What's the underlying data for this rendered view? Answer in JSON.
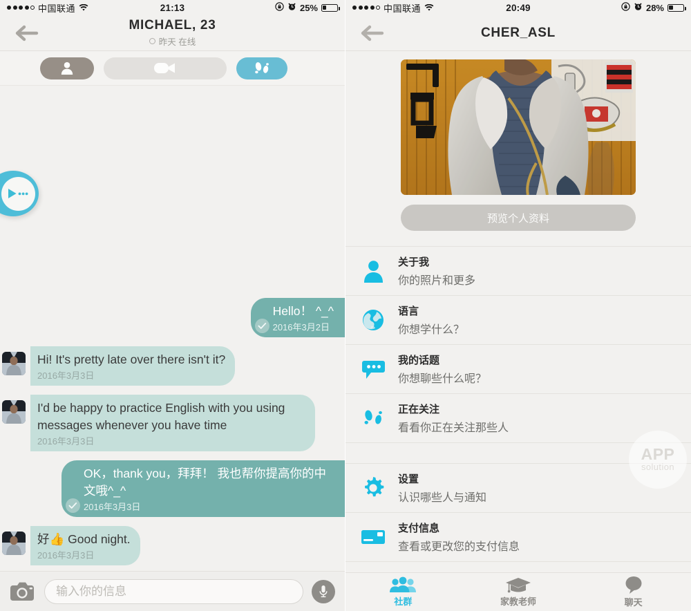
{
  "theme": {
    "accent_cyan": "#2ebde0",
    "accent_teal_bubble_out": "#74b1ac",
    "accent_mint_bubble_in": "#c5dfda",
    "page_bg": "#f2f1ef",
    "segment_active_footprint": "#68bdd4",
    "segment_profile": "#978f87",
    "segment_video": "#e2e0dd"
  },
  "left_phone": {
    "status_bar": {
      "signal_dots": 5,
      "signal_filled": 4,
      "carrier": "中国联通",
      "wifi_icon": "wifi-icon",
      "time": "21:13",
      "rotation_lock_icon": "rotation-lock-icon",
      "alarm_icon": "alarm-clock-icon",
      "battery_percent": "25%",
      "battery_level": 25
    },
    "nav": {
      "back_icon": "back-arrow-icon",
      "title": "MICHAEL, 23",
      "subtitle": "昨天 在线",
      "status_ring_icon": "status-ring-icon"
    },
    "segments": [
      {
        "name": "profile",
        "icon": "person-icon",
        "state": "inactive-dark"
      },
      {
        "name": "video",
        "icon": "video-camera-icon",
        "state": "disabled"
      },
      {
        "name": "footprint",
        "icon": "footprints-icon",
        "state": "active"
      }
    ],
    "floating_badge": {
      "icon": "pacman-chat-icon"
    },
    "messages": [
      {
        "side": "out",
        "text": "Hello！ ^_^",
        "time": "2016年3月2日",
        "read_receipt": true
      },
      {
        "side": "in",
        "text": "Hi! It's pretty late over there isn't it?",
        "time": "2016年3月3日",
        "avatar": "michael-avatar"
      },
      {
        "side": "in",
        "text": "I'd be happy to practice English with you using messages whenever you have time",
        "time": "2016年3月3日",
        "avatar": "michael-avatar"
      },
      {
        "side": "out",
        "text": "OK，thank you，拜拜！ 我也帮你提高你的中文哦^_^",
        "time": "2016年3月3日",
        "read_receipt": true
      },
      {
        "side": "in",
        "text": "好👍 Good night.",
        "time": "2016年3月3日",
        "avatar": "michael-avatar"
      }
    ],
    "input_bar": {
      "camera_icon": "camera-icon",
      "placeholder": "输入你的信息",
      "value": "",
      "mic_icon": "microphone-icon"
    }
  },
  "right_phone": {
    "status_bar": {
      "signal_dots": 5,
      "signal_filled": 4,
      "carrier": "中国联通",
      "wifi_icon": "wifi-icon",
      "time": "20:49",
      "rotation_lock_icon": "rotation-lock-icon",
      "alarm_icon": "alarm-clock-icon",
      "battery_percent": "28%",
      "battery_level": 28
    },
    "nav": {
      "back_icon": "back-arrow-icon",
      "title": "CHER_ASL"
    },
    "profile_photo": {
      "name": "profile-photo"
    },
    "preview_button": "预览个人资料",
    "settings_items": [
      {
        "icon": "person-icon",
        "title": "关于我",
        "subtitle": "你的照片和更多"
      },
      {
        "icon": "globe-icon",
        "title": "语言",
        "subtitle": "你想学什么？"
      },
      {
        "icon": "speech-bubble-icon",
        "title": "我的话题",
        "subtitle": "你想聊些什么呢？"
      },
      {
        "icon": "footprints-icon",
        "title": "正在关注",
        "subtitle": "看看你正在关注那些人"
      },
      {
        "icon": "gear-icon",
        "title": "设置",
        "subtitle": "认识哪些人与通知"
      },
      {
        "icon": "credit-card-icon",
        "title": "支付信息",
        "subtitle": "查看或更改您的支付信息"
      }
    ],
    "watermark": {
      "line1": "APP",
      "line2": "solution"
    },
    "tabs": [
      {
        "icon": "people-group-icon",
        "label": "社群",
        "active": true
      },
      {
        "icon": "graduation-cap-icon",
        "label": "家教老师",
        "active": false
      },
      {
        "icon": "chat-bubble-icon",
        "label": "聊天",
        "active": false
      }
    ]
  }
}
